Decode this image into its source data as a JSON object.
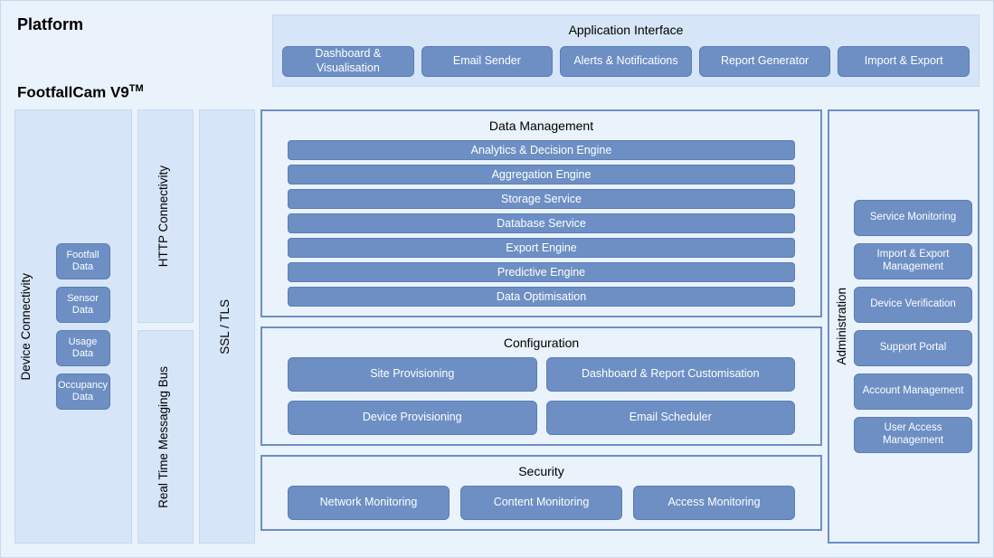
{
  "title_platform": "Platform",
  "title_product": "FootfallCam V9",
  "title_tm": "TM",
  "app_interface": {
    "title": "Application Interface",
    "items": [
      "Dashboard & Visualisation",
      "Email Sender",
      "Alerts & Notifications",
      "Report Generator",
      "Import & Export"
    ]
  },
  "device_connectivity": {
    "label": "Device Connectivity",
    "items": [
      "Footfall Data",
      "Sensor Data",
      "Usage Data",
      "Occupancy Data"
    ]
  },
  "http_label": "HTTP Connectivity",
  "rtm_label": "Real Time Messaging Bus",
  "ssl_label": "SSL / TLS",
  "data_mgmt": {
    "title": "Data Management",
    "items": [
      "Analytics & Decision Engine",
      "Aggregation Engine",
      "Storage Service",
      "Database Service",
      "Export Engine",
      "Predictive Engine",
      "Data Optimisation"
    ]
  },
  "config": {
    "title": "Configuration",
    "items": [
      "Site Provisioning",
      "Dashboard & Report Customisation",
      "Device Provisioning",
      "Email Scheduler"
    ]
  },
  "security": {
    "title": "Security",
    "items": [
      "Network Monitoring",
      "Content Monitoring",
      "Access Monitoring"
    ]
  },
  "admin": {
    "label": "Administration",
    "items": [
      "Service Monitoring",
      "Import & Export Management",
      "Device Verification",
      "Support Portal",
      "Account Management",
      "User Access Management"
    ]
  }
}
